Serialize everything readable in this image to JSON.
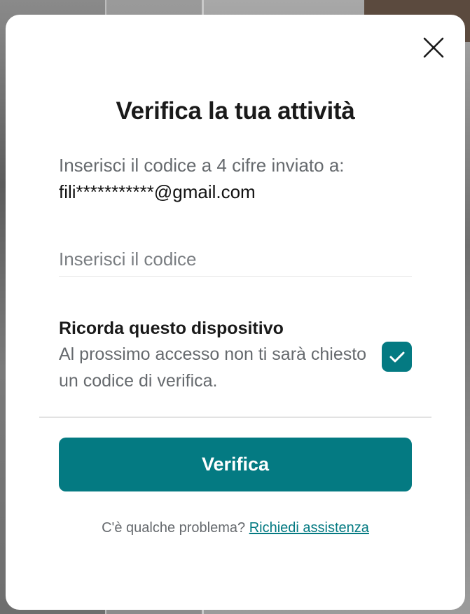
{
  "modal": {
    "title": "Verifica la tua attività",
    "instruction": "Inserisci il codice a 4 cifre inviato a:",
    "email": "fili***********@gmail.com",
    "code_placeholder": "Inserisci il codice",
    "code_value": "",
    "remember_title": "Ricorda questo dispositivo",
    "remember_description": "Al prossimo accesso non ti sarà chiesto un codice di verifica.",
    "remember_checked": true,
    "verify_label": "Verifica",
    "help_text": "C'è qualche problema?",
    "help_link": "Richiedi assistenza"
  },
  "icons": {
    "close": "close-icon",
    "check": "check-icon"
  },
  "colors": {
    "accent": "#047a82",
    "title_text": "#1a1a1a",
    "secondary_text": "#666a6e"
  }
}
